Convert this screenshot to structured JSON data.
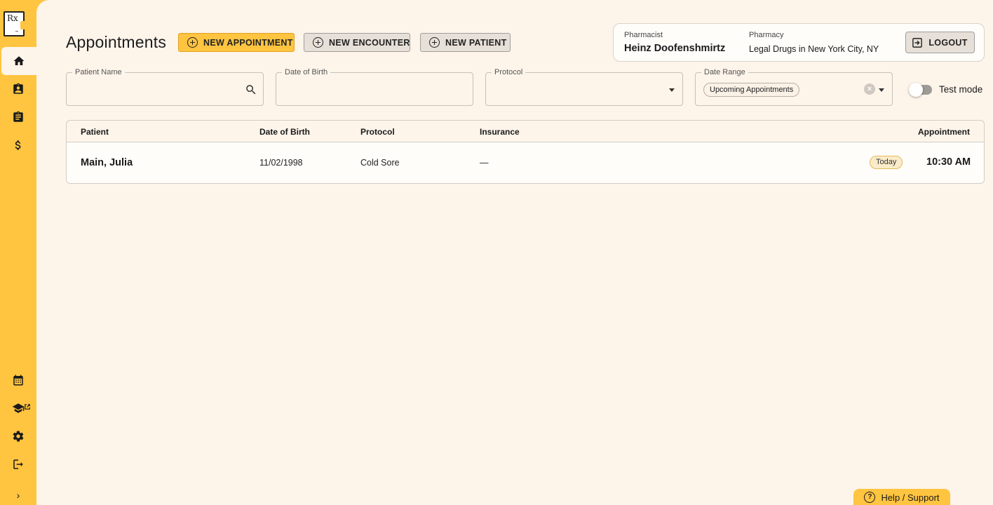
{
  "sidebar": {
    "logo_text": "Rx",
    "items_top": [
      "home-icon",
      "patient-badge-icon",
      "clipboard-icon",
      "dollar-icon"
    ],
    "items_bottom": [
      "calendar-icon",
      "graduation-cap-icon",
      "gear-icon",
      "logout-icon"
    ],
    "expand_glyph": "›"
  },
  "header": {
    "title": "Appointments",
    "new_appointment": "NEW APPOINTMENT",
    "new_encounter": "NEW ENCOUNTER",
    "new_patient": "NEW PATIENT"
  },
  "user_card": {
    "pharmacist_label": "Pharmacist",
    "pharmacist_name": "Heinz Doofenshmirtz",
    "pharmacy_label": "Pharmacy",
    "pharmacy_name": "Legal Drugs in New York City, NY",
    "logout_label": "LOGOUT"
  },
  "filters": {
    "patient_name": {
      "label": "Patient Name",
      "value": ""
    },
    "date_of_birth": {
      "label": "Date of Birth",
      "value": ""
    },
    "protocol": {
      "label": "Protocol",
      "value": ""
    },
    "date_range": {
      "label": "Date Range",
      "chip": "Upcoming Appointments"
    },
    "test_mode": {
      "label": "Test mode",
      "on": false
    }
  },
  "table": {
    "columns": [
      "Patient",
      "Date of Birth",
      "Protocol",
      "Insurance",
      "Appointment"
    ],
    "rows": [
      {
        "patient": "Main, Julia",
        "dob": "11/02/1998",
        "protocol": "Cold Sore",
        "insurance": "—",
        "badge": "Today",
        "time": "10:30 AM"
      }
    ]
  },
  "help": {
    "label": "Help / Support"
  },
  "colors": {
    "accent": "#ffc440",
    "background": "#fdf4ea",
    "text": "#1a1a1a"
  }
}
